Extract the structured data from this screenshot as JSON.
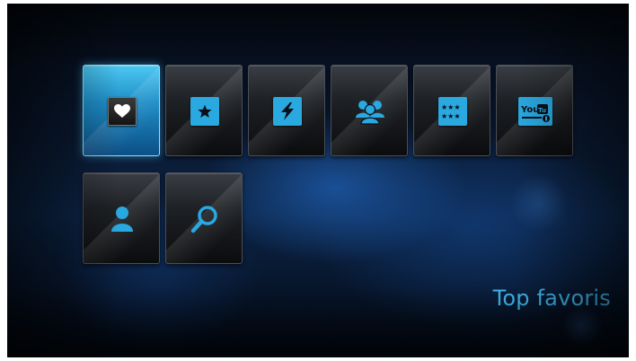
{
  "menu": {
    "tiles": [
      {
        "label": "Favorites",
        "icon": "heart-icon",
        "selected": true
      },
      {
        "label": "Featured",
        "icon": "star-icon",
        "selected": false
      },
      {
        "label": "Latest",
        "icon": "lightning-icon",
        "selected": false
      },
      {
        "label": "Most popular",
        "icon": "people-icon",
        "selected": false
      },
      {
        "label": "Top rated",
        "icon": "ratings-icon",
        "selected": false
      },
      {
        "label": "YouTube",
        "icon": "youtube-icon",
        "selected": false
      },
      {
        "label": "Account",
        "icon": "user-icon",
        "selected": false
      },
      {
        "label": "Search",
        "icon": "search-icon",
        "selected": false
      }
    ]
  },
  "caption": {
    "text": "Top favoris"
  },
  "colors": {
    "accent": "#2aa8e0",
    "caption": "#3fb7ee",
    "selected_tile": "#1f8fc8"
  }
}
